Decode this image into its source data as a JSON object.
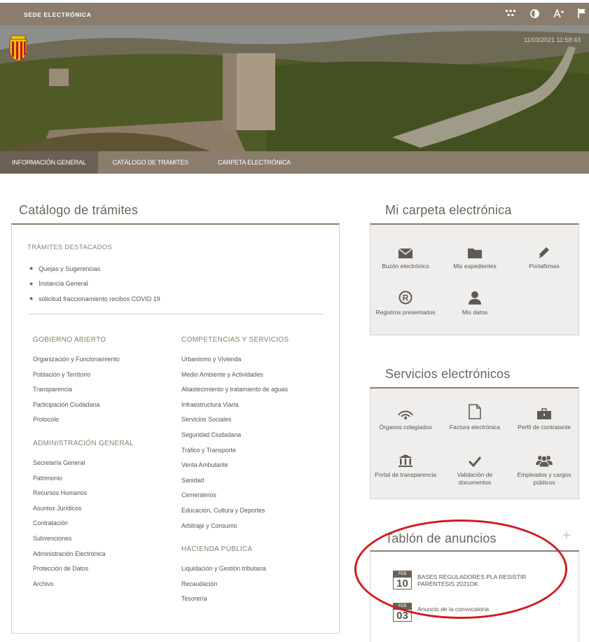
{
  "header": {
    "site_title": "SEDE ELECTRÓNICA",
    "datetime": "11/03/2021 11:58:43"
  },
  "nav": {
    "items": [
      {
        "label": "INFORMACIÓN GENERAL"
      },
      {
        "label": "CATÁLOGO DE TRÁMITES"
      },
      {
        "label": "CARPETA ELECTRÓNICA"
      }
    ]
  },
  "catalog": {
    "title": "Catálogo de trámites",
    "featured_title": "TRÁMITES DESTACADOS",
    "featured": [
      "Quejas y Sugerencias",
      "Instancia General",
      "solicitud fraccionamiento recibos COVID 19"
    ],
    "gobierno_title": "GOBIERNO ABIERTO",
    "gobierno": [
      "Organización y Funcionamiento",
      "Población y Territorio",
      "Transparencia",
      "Participación Ciudadana",
      "Protocolo"
    ],
    "admin_title": "ADMINISTRACIÓN GENERAL",
    "admin": [
      "Secretaría General",
      "Patrimonio",
      "Recursos Humanos",
      "Asuntos Jurídicos",
      "Contratación",
      "Subvenciones",
      "Administración Electrónica",
      "Protección de Datos",
      "Archivo"
    ],
    "competencias_title": "COMPETENCIAS Y SERVICIOS",
    "competencias": [
      "Urbanismo y Vivienda",
      "Medio Ambiente y Actividades",
      "Abastecimiento y tratamiento de aguas",
      "Infraestructura Viaria",
      "Servicios Sociales",
      "Seguridad Ciudadana",
      "Tráfico y Transporte",
      "Venta Ambulante",
      "Sanidad",
      "Cementerios",
      "Educación, Cultura y Deportes",
      "Arbitraje y Consumo"
    ],
    "hacienda_title": "HACIENDA PÚBLICA",
    "hacienda": [
      "Liquidación y Gestión tributaria",
      "Recaudación",
      "Tesorería"
    ]
  },
  "carpeta": {
    "title": "Mi carpeta electrónica",
    "tiles": [
      {
        "label": "Buzón electrónico",
        "icon": "envelope-icon"
      },
      {
        "label": "Mis expedientes",
        "icon": "folder-icon"
      },
      {
        "label": "Portafirmas",
        "icon": "pen-nib-icon"
      },
      {
        "label": "Registros presentados",
        "icon": "registered-icon"
      },
      {
        "label": "Mis datos",
        "icon": "user-icon"
      }
    ]
  },
  "servicios": {
    "title": "Servicios electrónicos",
    "tiles": [
      {
        "label": "Órganos colegiados",
        "icon": "signal-icon"
      },
      {
        "label": "Factura electrónica",
        "icon": "document-icon"
      },
      {
        "label": "Perfil de contratante",
        "icon": "briefcase-icon"
      },
      {
        "label": "Portal de transparencia",
        "icon": "institution-icon"
      },
      {
        "label": "Validación de documentos",
        "icon": "checkmark-icon"
      },
      {
        "label": "Empleados y cargos públicos",
        "icon": "group-icon"
      }
    ]
  },
  "tablon": {
    "title": "Tablón de anuncios",
    "plus": "+",
    "notices": [
      {
        "month": "FEB",
        "day": "10",
        "text": "BASES REGULADORES PLA RESISTIR PARÉNTESIS 2021OK"
      },
      {
        "month": "FEB",
        "day": "03",
        "text": "Anuncio de la convocatoria"
      }
    ]
  },
  "colors": {
    "brand": "#8a7d6d",
    "brand_dark": "#6b6054",
    "annotation": "#d11a22"
  }
}
